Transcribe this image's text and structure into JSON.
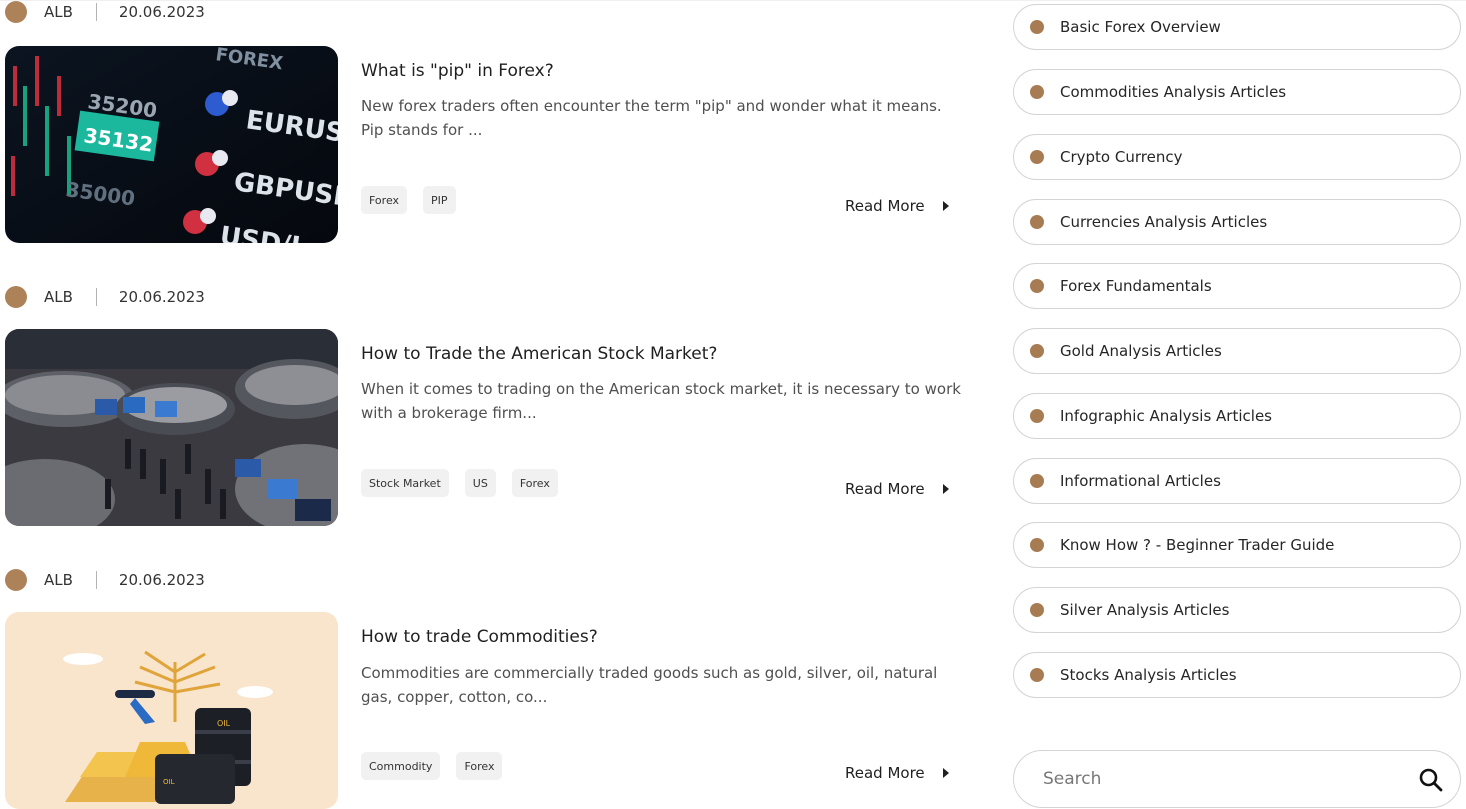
{
  "articles": [
    {
      "author": "ALB",
      "date": "20.06.2023",
      "title": "What is \"pip\" in Forex?",
      "excerpt": "New forex traders often encounter the term \"pip\" and wonder what it means. Pip stands for ...",
      "tags": [
        "Forex",
        "PIP"
      ],
      "read_more": "Read More",
      "image": {
        "icon": "forex-quotes-screen",
        "texts": [
          "FOREX",
          "35200",
          "35132",
          "35000",
          "EURUSD",
          "GBPUSD",
          "USD/J"
        ]
      }
    },
    {
      "author": "ALB",
      "date": "20.06.2023",
      "title": "How to Trade the American Stock Market?",
      "excerpt": "When it comes to trading on the American stock market, it is necessary to work with a brokerage firm...",
      "tags": [
        "Stock Market",
        "US",
        "Forex"
      ],
      "read_more": "Read More",
      "image": {
        "icon": "stock-exchange-floor-photo"
      }
    },
    {
      "author": "ALB",
      "date": "20.06.2023",
      "title": "How to trade Commodities?",
      "excerpt": "Commodities are commercially traded goods such as gold, silver, oil, natural gas, copper, cotton, co...",
      "tags": [
        "Commodity",
        "Forex"
      ],
      "read_more": "Read More",
      "image": {
        "icon": "commodities-illustration",
        "texts": [
          "OIL",
          "OIL"
        ]
      }
    }
  ],
  "sidebar": {
    "categories": [
      "Basic Forex Overview",
      "Commodities Analysis Articles",
      "Crypto Currency",
      "Currencies Analysis Articles",
      "Forex Fundamentals",
      "Gold Analysis Articles",
      "Infographic Analysis Articles",
      "Informational Articles",
      "Know How ? - Beginner Trader Guide",
      "Silver Analysis Articles",
      "Stocks Analysis Articles"
    ],
    "search": {
      "placeholder": "Search",
      "icon": "search-icon"
    }
  },
  "colors": {
    "accent": "#ad8259",
    "tag_bg": "#f1f1f1",
    "border": "#d4d4d4"
  }
}
